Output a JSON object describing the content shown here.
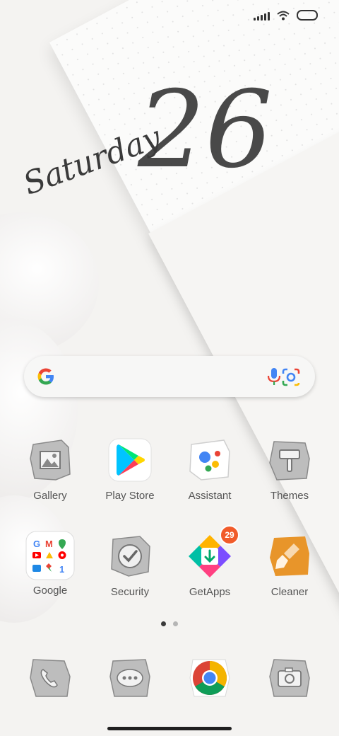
{
  "clock_widget": {
    "day": "Saturday",
    "date": "26"
  },
  "search": {
    "google": "G"
  },
  "apps": [
    {
      "label": "Gallery"
    },
    {
      "label": "Play Store"
    },
    {
      "label": "Assistant"
    },
    {
      "label": "Themes"
    },
    {
      "label": "Google",
      "folder_icons": [
        "gmail-icon",
        "maps-icon",
        "photos-icon",
        "youtube-icon",
        "drive-icon",
        "youtube-music-icon",
        "duo-icon",
        "pinwheel-icon",
        "one-icon"
      ]
    },
    {
      "label": "Security"
    },
    {
      "label": "GetApps",
      "badge": "29"
    },
    {
      "label": "Cleaner"
    }
  ],
  "dock": [
    {
      "icon": "phone-icon"
    },
    {
      "icon": "messages-icon"
    },
    {
      "icon": "chrome-icon"
    },
    {
      "icon": "camera-icon"
    }
  ],
  "page_indicator": {
    "pages": 2,
    "active": 1
  },
  "colors": {
    "badge": "#f15b2a",
    "cleaner": "#e8952a",
    "handwriting": "#3a3a3a"
  }
}
